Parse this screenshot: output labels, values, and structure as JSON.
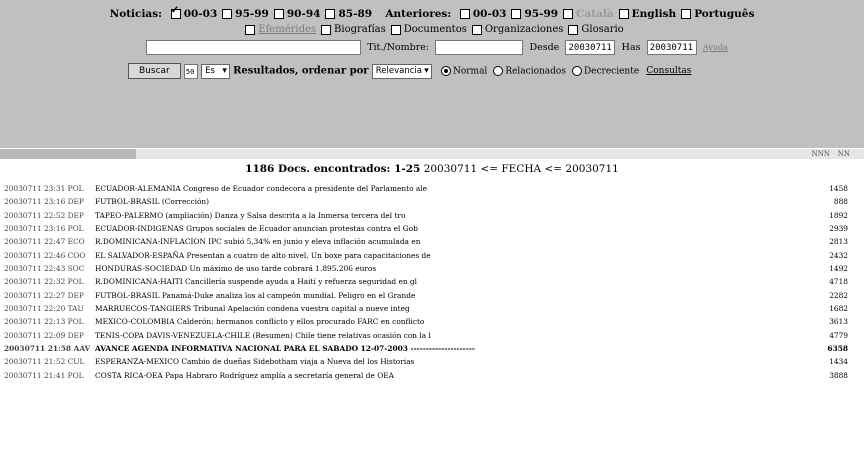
{
  "filter_row": {
    "noticias_label": "Noticias:",
    "year_options": [
      {
        "label": "00-03",
        "checked": true
      },
      {
        "label": "95-99",
        "checked": false
      },
      {
        "label": "90-94",
        "checked": false
      },
      {
        "label": "85-89",
        "checked": false
      }
    ],
    "anteriores_label": "Anteriores:",
    "older_options": [
      {
        "label": "00-03",
        "checked": false
      },
      {
        "label": "95-99",
        "checked": false
      },
      {
        "label": "Català",
        "checked": false,
        "disabled": true
      },
      {
        "label": "English",
        "checked": false
      },
      {
        "label": "Português",
        "checked": false
      }
    ]
  },
  "type_row": {
    "items": [
      {
        "label": "Efemérides",
        "checked": false,
        "is_link": true
      },
      {
        "label": "Biografías",
        "checked": false
      },
      {
        "label": "Documentos",
        "checked": false
      },
      {
        "label": "Organizaciones",
        "checked": false
      },
      {
        "label": "Glosario",
        "checked": false
      }
    ]
  },
  "search_row": {
    "query_value": "",
    "title_label": "Tit./Nombre:",
    "title_value": "",
    "from_label": "Desde",
    "from_value": "20030711",
    "to_label": "Has",
    "to_value": "20030711",
    "help_link": "Ayuda"
  },
  "action_row": {
    "search_button": "Buscar",
    "small_box": "50",
    "small_select": "Es",
    "results_label": "Resultados, ordenar por",
    "sort_select": "Relevancia",
    "order_options": [
      {
        "label": "Normal",
        "on": true
      },
      {
        "label": "Relacionados",
        "on": false
      },
      {
        "label": "Decreciente",
        "on": false
      }
    ],
    "consultas_link": "Consultas"
  },
  "pager": {
    "page_label": "NNN",
    "next_label": "NN"
  },
  "results_header": {
    "count_text": "1186 Docs. encontrados: 1-25",
    "range_text": "20030711 <= FECHA <= 20030711"
  },
  "results": [
    {
      "ts": "20030711 23:31 POL",
      "text": "ECUADOR-ALEMANIA Congreso de Ecuador condecora a presidente del Parlamento ale",
      "size": "1458"
    },
    {
      "ts": "20030711 23:16 DEP",
      "text": "FUTBOL-BRASIL (Corrección)",
      "size": "888"
    },
    {
      "ts": "20030711 22:52 DEP",
      "text": "TAPEO-PALERMO (ampliación) Danza y Salsa descrita a la Inmersa tercera del tro",
      "size": "1892"
    },
    {
      "ts": "20030711 23:16 POL",
      "text": "ECUADOR-INDIGENAS Grupos sociales de Ecuador anuncian protestas contra el Gob",
      "size": "2939"
    },
    {
      "ts": "20030711 22:47 ECO",
      "text": "R.DOMINICANA-INFLACION IPC subió 5,34% en junio y eleva inflación acumulada en",
      "size": "2813"
    },
    {
      "ts": "20030711 22:46 COO",
      "text": "EL SALVADOR-ESPAÑA Presentan a cuatro de alto nivel. Un boxe para capacitaciones de",
      "size": "2432"
    },
    {
      "ts": "20030711 22:43 SOC",
      "text": "HONDURAS-SOCIEDAD Un máximo de uso tarde cobrará 1.895.206 euros",
      "size": "1492"
    },
    {
      "ts": "20030711 22:32 POL",
      "text": "R.DOMINICANA-HAITI Cancillería suspende ayuda a Haití y refuerza seguridad en gl",
      "size": "4718"
    },
    {
      "ts": "20030711 22:27 DEP",
      "text": "FUTBOL-BRASIL Panamá-Duke analiza los al campeón mundial. Peligro en el Grande",
      "size": "2282"
    },
    {
      "ts": "20030711 22:20 TAU",
      "text": "MARRUECOS-TANGIERS Tribunal Apelación condena vuestra capital a nueve integ",
      "size": "1682"
    },
    {
      "ts": "20030711 22:13 POL",
      "text": "MEXICO-COLOMBIA Calderón: hermanos conflicto y ellos procurado FARC en conflicto",
      "size": "3613"
    },
    {
      "ts": "20030711 22:09 DEP",
      "text": "TENIS-COPA DAVIS-VENEZUELA-CHILE (Resumen) Chile tiene relativas ocasión con la l",
      "size": "4779"
    },
    {
      "ts": "20030711 21:58 AAV",
      "text": "AVANCE AGENDA INFORMATIVA NACIONAL PARA EL SABADO 12-07-2003 ---------------------",
      "size": "6358",
      "bold": true
    },
    {
      "ts": "20030711 21:52 CUL",
      "text": "ESPERANZA-MEXICO Cambio de dueñas Sidebotham viaja a Nueva del los Historias",
      "size": "1434"
    },
    {
      "ts": "20030711 21:41 POL",
      "text": "COSTA RICA-OEA Papa Habraro Rodríguez amplía a secretaría general de OEA",
      "size": "3888"
    }
  ]
}
